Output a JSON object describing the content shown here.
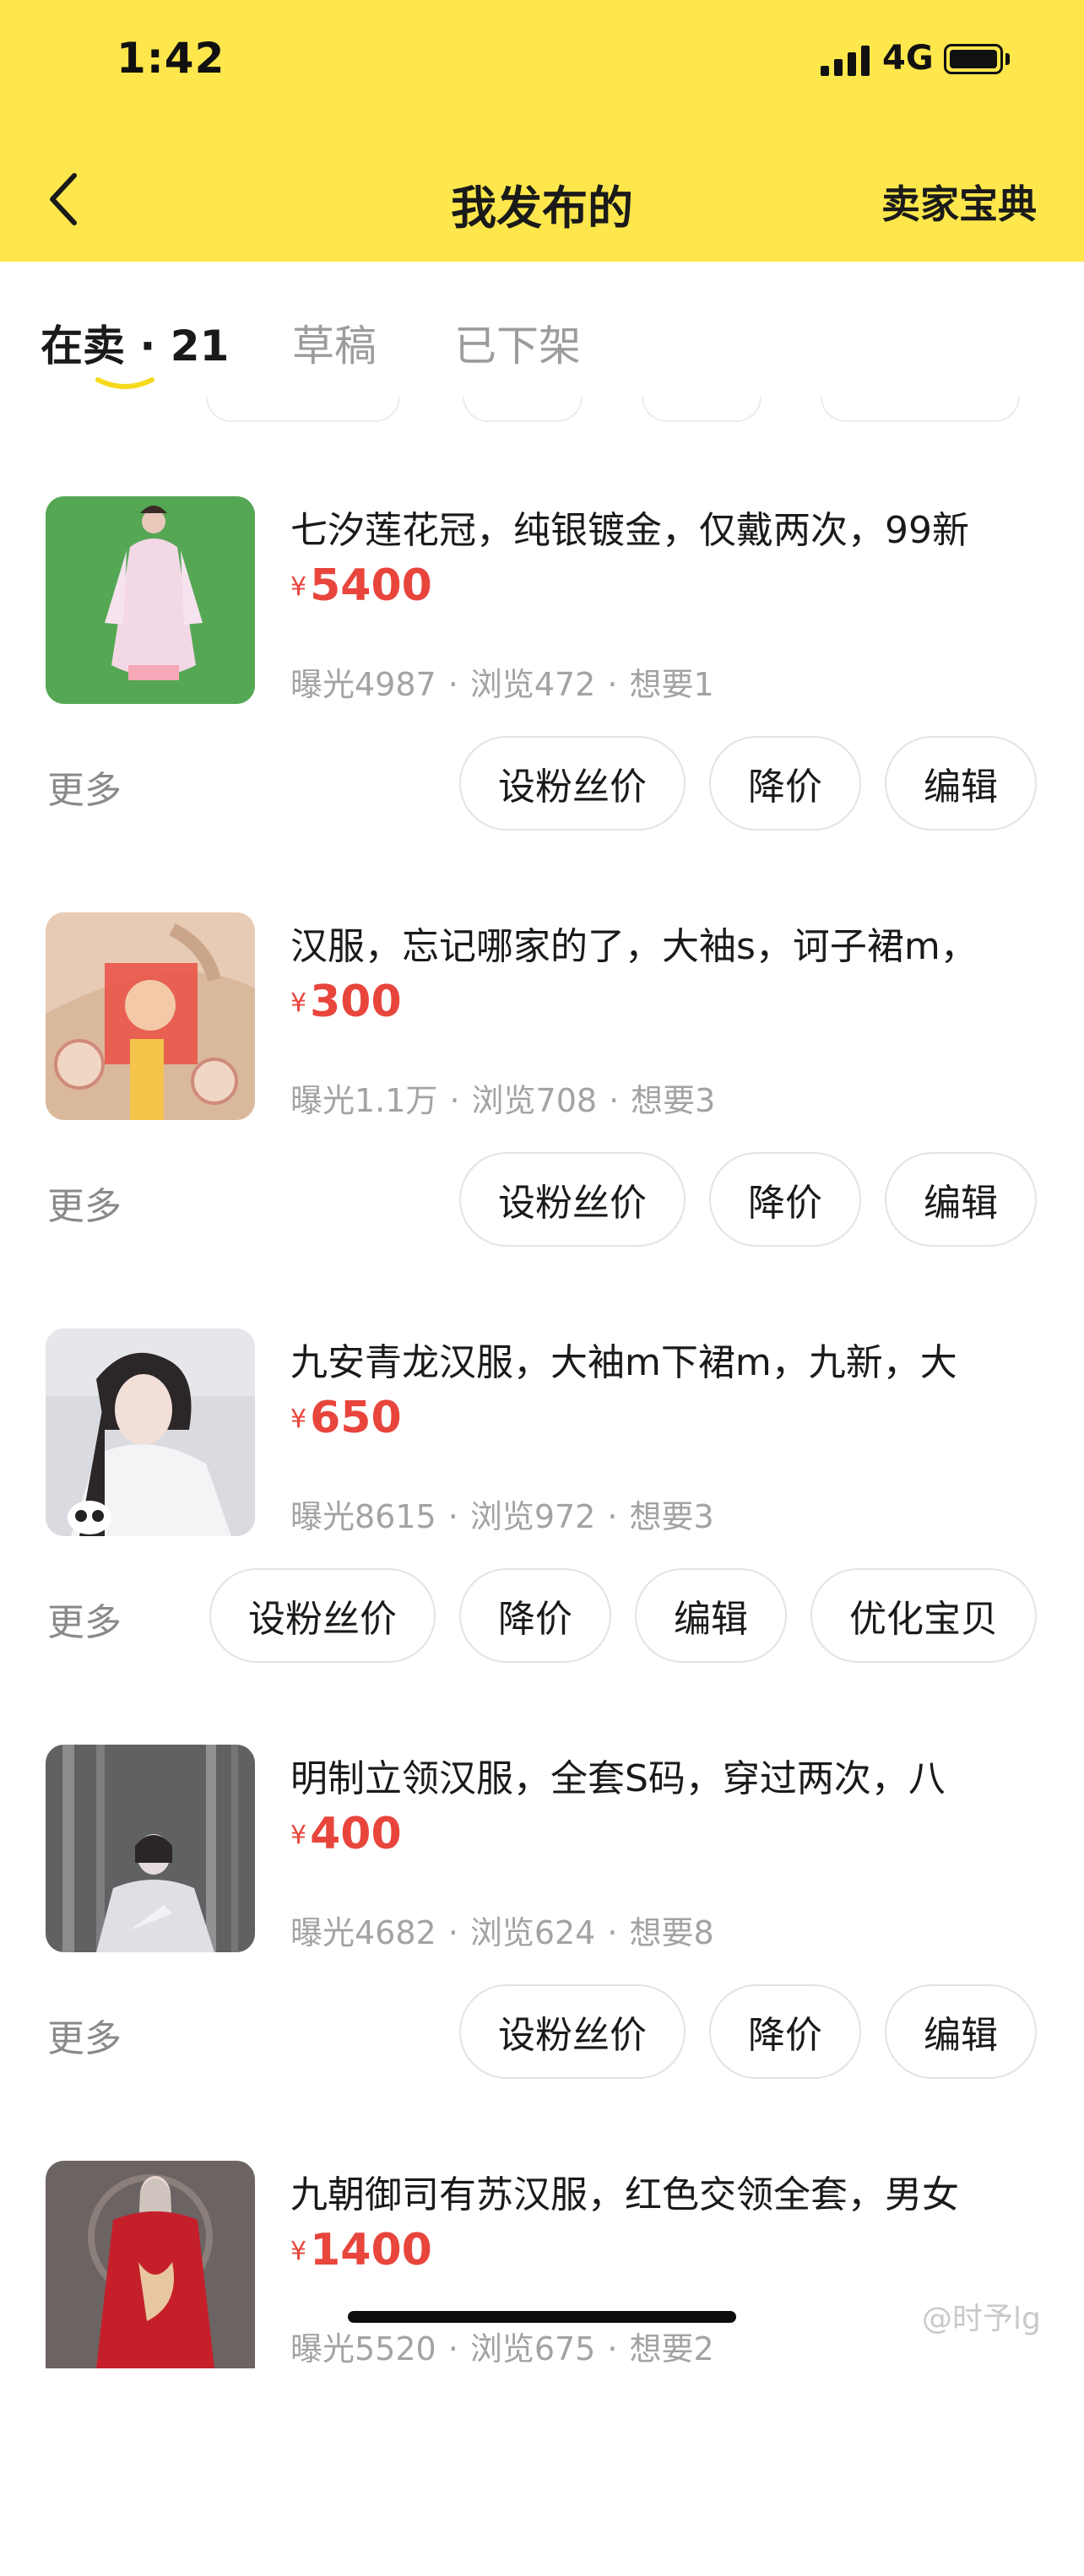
{
  "status": {
    "time": "1:42",
    "network": "4G"
  },
  "nav": {
    "title": "我发布的",
    "right_link": "卖家宝典"
  },
  "tabs": [
    {
      "label": "在卖 · 21",
      "active": true
    },
    {
      "label": "草稿",
      "active": false
    },
    {
      "label": "已下架",
      "active": false
    }
  ],
  "currency_symbol": "¥",
  "more_label": "更多",
  "items": [
    {
      "title": "七汐莲花冠，纯银镀金，仅戴两次，99新",
      "price": "5400",
      "stats": [
        "曝光4987",
        "浏览472",
        "想要1"
      ],
      "actions": [
        "设粉丝价",
        "降价",
        "编辑"
      ]
    },
    {
      "title": "汉服，忘记哪家的了，大袖s，诃子裙m，",
      "price": "300",
      "stats": [
        "曝光1.1万",
        "浏览708",
        "想要3"
      ],
      "actions": [
        "设粉丝价",
        "降价",
        "编辑"
      ]
    },
    {
      "title": "九安青龙汉服，大袖m下裙m，九新，大",
      "price": "650",
      "stats": [
        "曝光8615",
        "浏览972",
        "想要3"
      ],
      "actions": [
        "设粉丝价",
        "降价",
        "编辑",
        "优化宝贝"
      ]
    },
    {
      "title": "明制立领汉服，全套S码，穿过两次，八",
      "price": "400",
      "stats": [
        "曝光4682",
        "浏览624",
        "想要8"
      ],
      "actions": [
        "设粉丝价",
        "降价",
        "编辑"
      ]
    },
    {
      "title": "九朝御司有苏汉服，红色交领全套，男女",
      "price": "1400",
      "stats": [
        "曝光5520",
        "浏览675",
        "想要2"
      ],
      "actions": []
    }
  ],
  "watermark": "@时予lg"
}
